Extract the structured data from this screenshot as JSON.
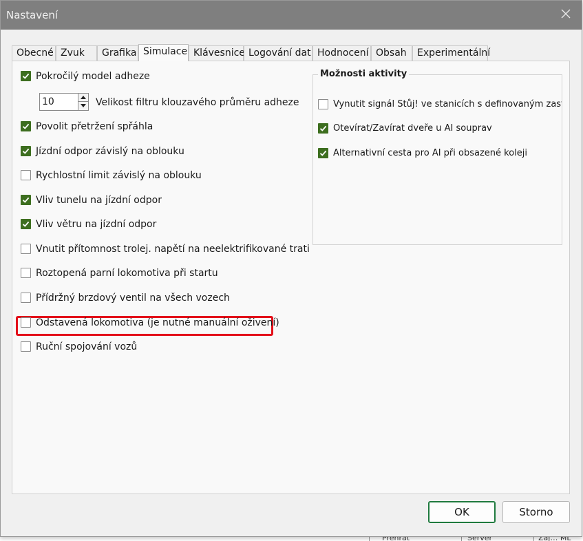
{
  "window": {
    "title": "Nastavení"
  },
  "tabs": [
    {
      "label": "Obecné",
      "active": false
    },
    {
      "label": "Zvuk",
      "active": false
    },
    {
      "label": "Grafika",
      "active": false
    },
    {
      "label": "Simulace",
      "active": true
    },
    {
      "label": "Klávesnice",
      "active": false
    },
    {
      "label": "Logování dat",
      "active": false
    },
    {
      "label": "Hodnocení",
      "active": false
    },
    {
      "label": "Obsah",
      "active": false
    },
    {
      "label": "Experimentální",
      "active": false
    }
  ],
  "simulation": {
    "options": [
      {
        "label": "Pokročilý model adheze",
        "checked": true
      },
      {
        "label": "Povolit přetržení spřáhla",
        "checked": true
      },
      {
        "label": "Jízdní odpor závislý na oblouku",
        "checked": true
      },
      {
        "label": "Rychlostní limit závislý na oblouku",
        "checked": false
      },
      {
        "label": "Vliv tunelu na jízdní odpor",
        "checked": true
      },
      {
        "label": "Vliv větru na jízdní odpor",
        "checked": true
      },
      {
        "label": "Vnutit přítomnost trolej. napětí na neelektrifikované trati",
        "checked": false
      },
      {
        "label": "Roztopená parní lokomotiva při startu",
        "checked": false
      },
      {
        "label": "Přídržný brzdový ventil na všech vozech",
        "checked": false
      },
      {
        "label": "Odstavená lokomotiva (je nutné manuální oživení)",
        "checked": false
      },
      {
        "label": "Ruční spojování vozů",
        "checked": false
      }
    ],
    "adhesion_filter": {
      "value": "10",
      "label": "Velikost filtru klouzavého průměru adheze"
    }
  },
  "activity": {
    "title": "Možnosti aktivity",
    "options": [
      {
        "label": "Vynutit signál Stůj! ve stanicích s definovaným zastav",
        "checked": false
      },
      {
        "label": "Otevírat/Zavírat dveře u AI souprav",
        "checked": true
      },
      {
        "label": "Alternativní cesta pro AI při obsazené koleji",
        "checked": true
      }
    ]
  },
  "buttons": {
    "ok": "OK",
    "cancel": "Storno"
  },
  "background_window": {
    "cells": [
      "Přehrát",
      "Server",
      "Zaj… ML"
    ]
  },
  "colors": {
    "titlebar": "#7f7f7f",
    "check": "#3d6e1f",
    "highlight": "#e3101a",
    "ok_border": "#1f7a3e"
  }
}
